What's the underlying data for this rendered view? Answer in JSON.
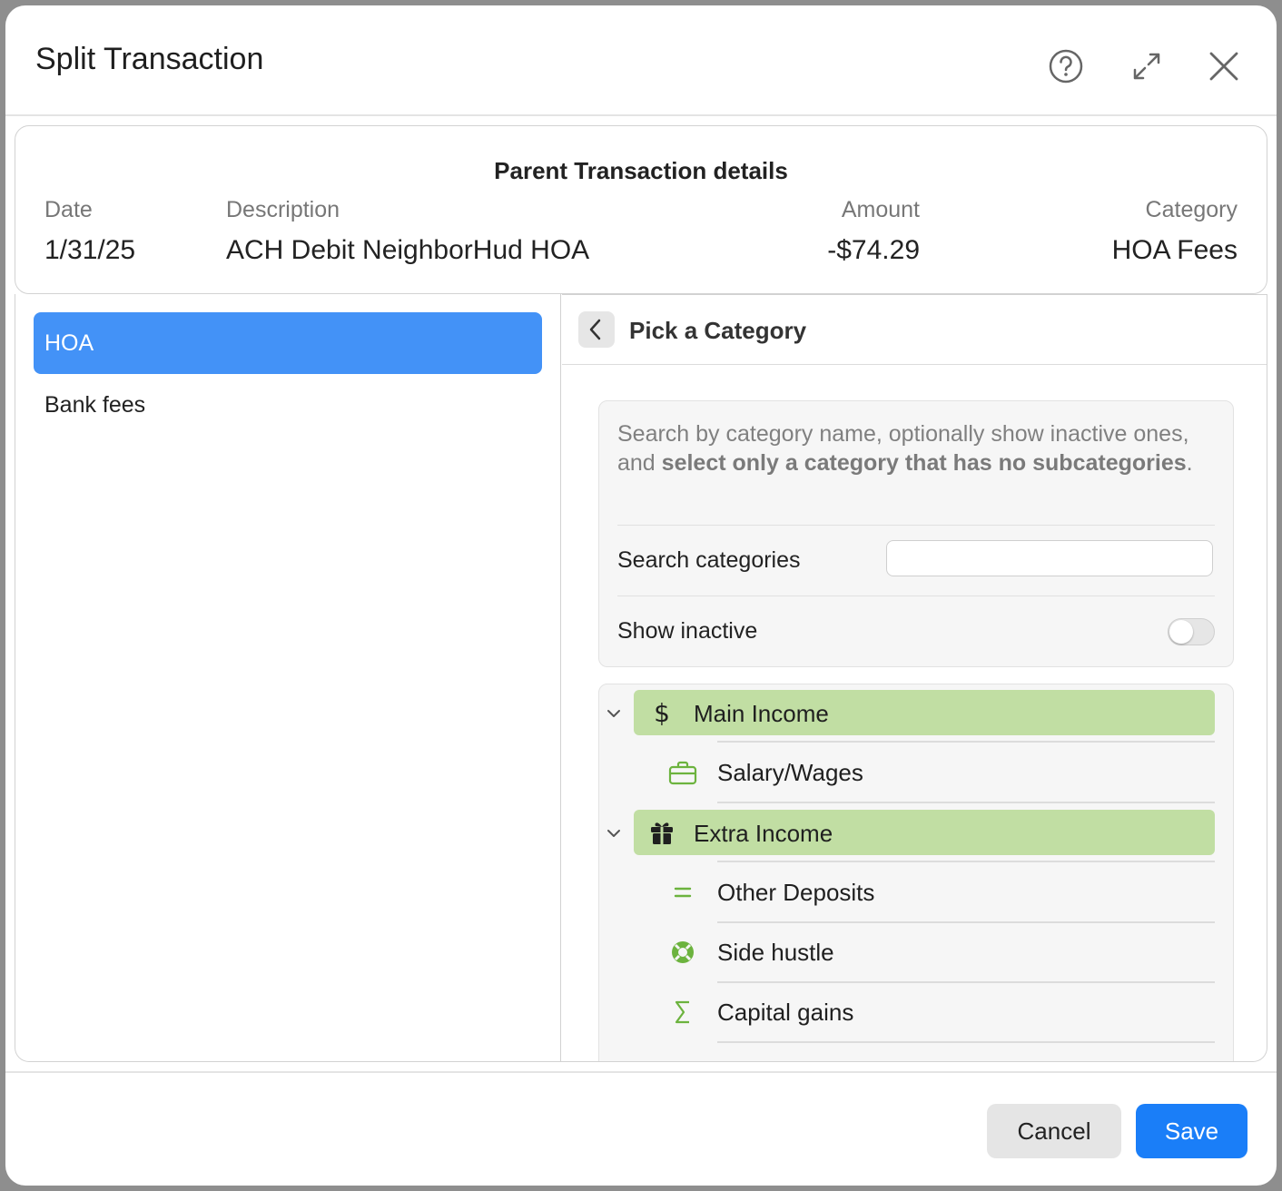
{
  "window": {
    "title": "Split Transaction"
  },
  "header_icons": [
    "help-icon",
    "expand-icon",
    "close-icon"
  ],
  "parent": {
    "heading": "Parent Transaction details",
    "date_label": "Date",
    "date": "1/31/25",
    "description_label": "Description",
    "description": "ACH Debit NeighborHud HOA",
    "amount_label": "Amount",
    "amount": "-$74.29",
    "category_label": "Category",
    "category": "HOA Fees"
  },
  "splits": [
    {
      "label": "HOA",
      "selected": true
    },
    {
      "label": "Bank fees",
      "selected": false
    }
  ],
  "picker": {
    "title": "Pick a Category",
    "hint_prefix": "Search by category name, optionally show inactive ones, and ",
    "hint_bold": "select only a category that has no subcategories",
    "hint_suffix": ".",
    "search_label": "Search categories",
    "search_value": "",
    "show_inactive_label": "Show inactive",
    "show_inactive": false
  },
  "tree": {
    "groups": [
      {
        "label": "Main Income",
        "icon": "dollar-icon",
        "expanded": true,
        "children": [
          {
            "label": "Salary/Wages",
            "icon": "briefcase-icon"
          }
        ]
      },
      {
        "label": "Extra Income",
        "icon": "gift-icon",
        "expanded": true,
        "children": [
          {
            "label": "Other Deposits",
            "icon": "equals-icon"
          },
          {
            "label": "Side hustle",
            "icon": "lifebuoy-icon"
          },
          {
            "label": "Capital gains",
            "icon": "sigma-icon"
          }
        ]
      }
    ]
  },
  "footer": {
    "cancel_label": "Cancel",
    "save_label": "Save"
  },
  "colors": {
    "accent": "#1a7ef8",
    "selected_split": "#4392f7",
    "group_pill": "#c1dea3",
    "category_icon": "#6cb33e"
  }
}
